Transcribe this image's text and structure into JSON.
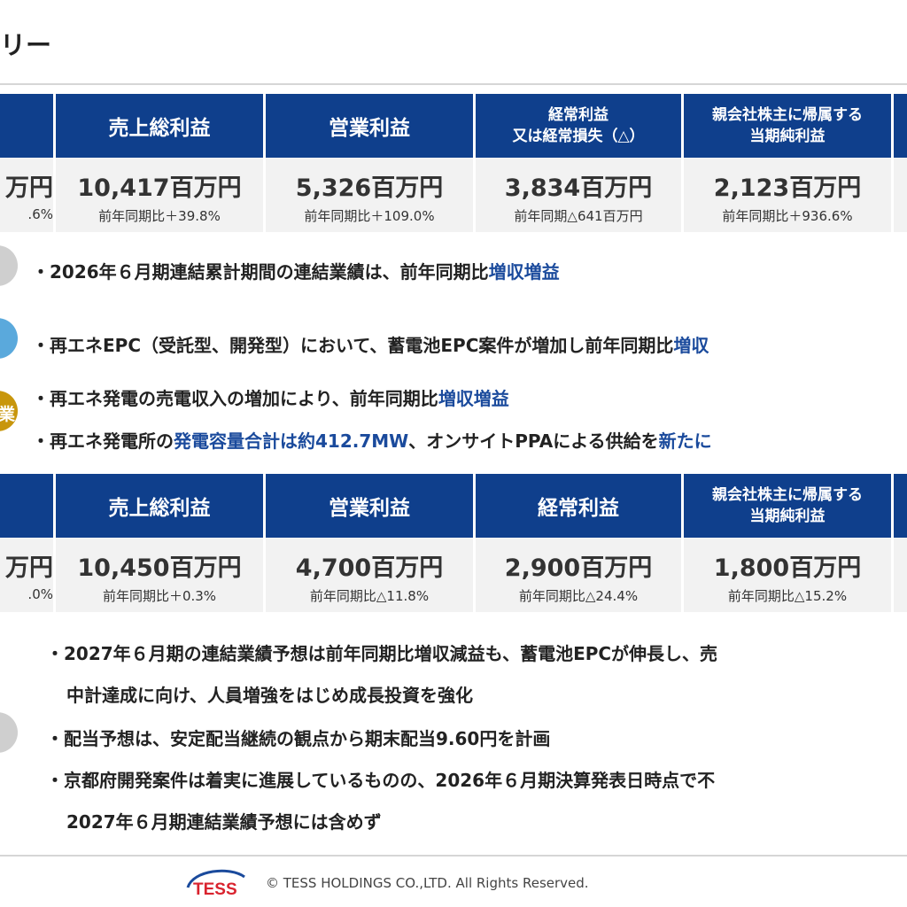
{
  "page": {
    "title": "リー"
  },
  "table1": {
    "first_main": "万円",
    "first_sub": ".6%",
    "columns": [
      {
        "header": "売上総利益",
        "value": "10,417百万円",
        "change": "前年同期比＋39.8%"
      },
      {
        "header": "営業利益",
        "value": "5,326百万円",
        "change": "前年同期比＋109.0%"
      },
      {
        "header_line1": "経常利益",
        "header_line2": "又は経常損失（△）",
        "value": "3,834百万円",
        "change": "前年同期△641百万円"
      },
      {
        "header_line1": "親会社株主に帰属する",
        "header_line2": "当期純利益",
        "value": "2,123百万円",
        "change": "前年同期比＋936.6%"
      }
    ]
  },
  "summary": {
    "items": [
      {
        "text": "・2026年６月期連結累計期間の連結業績は、前年同期比",
        "highlight": "増収増益",
        "tail": ""
      },
      {
        "text": "・再エネEPC（受託型、開発型）において、蓄電池EPC案件が増加し前年同期比",
        "highlight": "増収",
        "tail": ""
      },
      {
        "text": "・再エネ発電の売電収入の増加により、前年同期比",
        "highlight": "増収増益",
        "tail": ""
      },
      {
        "text": "・再エネ発電所の",
        "highlight": "発電容量合計は約412.7MW",
        "tail": "、オンサイトPPAによる供給を",
        "highlight2": "新たに"
      }
    ],
    "circle_label": "業",
    "colors": {
      "grey": "#cfcfcf",
      "blue": "#5aa9dc",
      "gold": "#c8960c"
    }
  },
  "table2": {
    "first_main": "万円",
    "first_sub": ".0%",
    "columns": [
      {
        "header": "売上総利益",
        "value": "10,450百万円",
        "change": "前年同期比＋0.3%"
      },
      {
        "header": "営業利益",
        "value": "4,700百万円",
        "change": "前年同期比△11.8%"
      },
      {
        "header": "経常利益",
        "value": "2,900百万円",
        "change": "前年同期比△24.4%"
      },
      {
        "header_line1": "親会社株主に帰属する",
        "header_line2": "当期純利益",
        "value": "1,800百万円",
        "change": "前年同期比△15.2%"
      }
    ]
  },
  "forecast": {
    "items": [
      "・2027年６月期の連結業績予想は前年同期比増収減益も、蓄電池EPCが伸長し、売",
      "中計達成に向け、人員増強をはじめ成長投資を強化",
      "・配当予想は、安定配当継続の観点から期末配当9.60円を計画",
      "・京都府開発案件は着実に進展しているものの、2026年６月期決算発表日時点で不",
      "2027年６月期連結業績予想には含めず"
    ]
  },
  "footer": {
    "logo_text": "TESS",
    "copyright": "© TESS HOLDINGS CO.,LTD. All Rights Reserved."
  },
  "colors": {
    "header_bg": "#0f3f8c",
    "cell_bg": "#f2f2f2",
    "highlight": "#1a4a9c"
  }
}
